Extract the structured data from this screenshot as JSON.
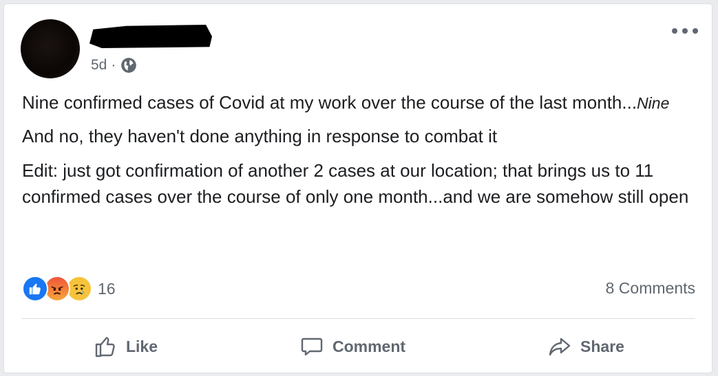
{
  "post": {
    "time": "5d",
    "separator": "·",
    "paragraphs": {
      "p1": "Nine confirmed cases of Covid at my work over the course of the last month...",
      "p1_em": "Nine",
      "p2": "And no, they haven't done anything in response to combat it",
      "p3": "Edit: just got confirmation of another 2 cases at our location; that brings us to 11 confirmed cases over the course of only one month...and we are somehow still open"
    }
  },
  "reactions": {
    "types": [
      "like-icon",
      "angry-icon",
      "sad-icon"
    ],
    "count": "16"
  },
  "comments": {
    "label": "8 Comments"
  },
  "actions": {
    "like": "Like",
    "comment": "Comment",
    "share": "Share"
  },
  "colors": {
    "like_blue": "#1877f2",
    "secondary_text": "#606770",
    "primary_text": "#1c1e21"
  }
}
